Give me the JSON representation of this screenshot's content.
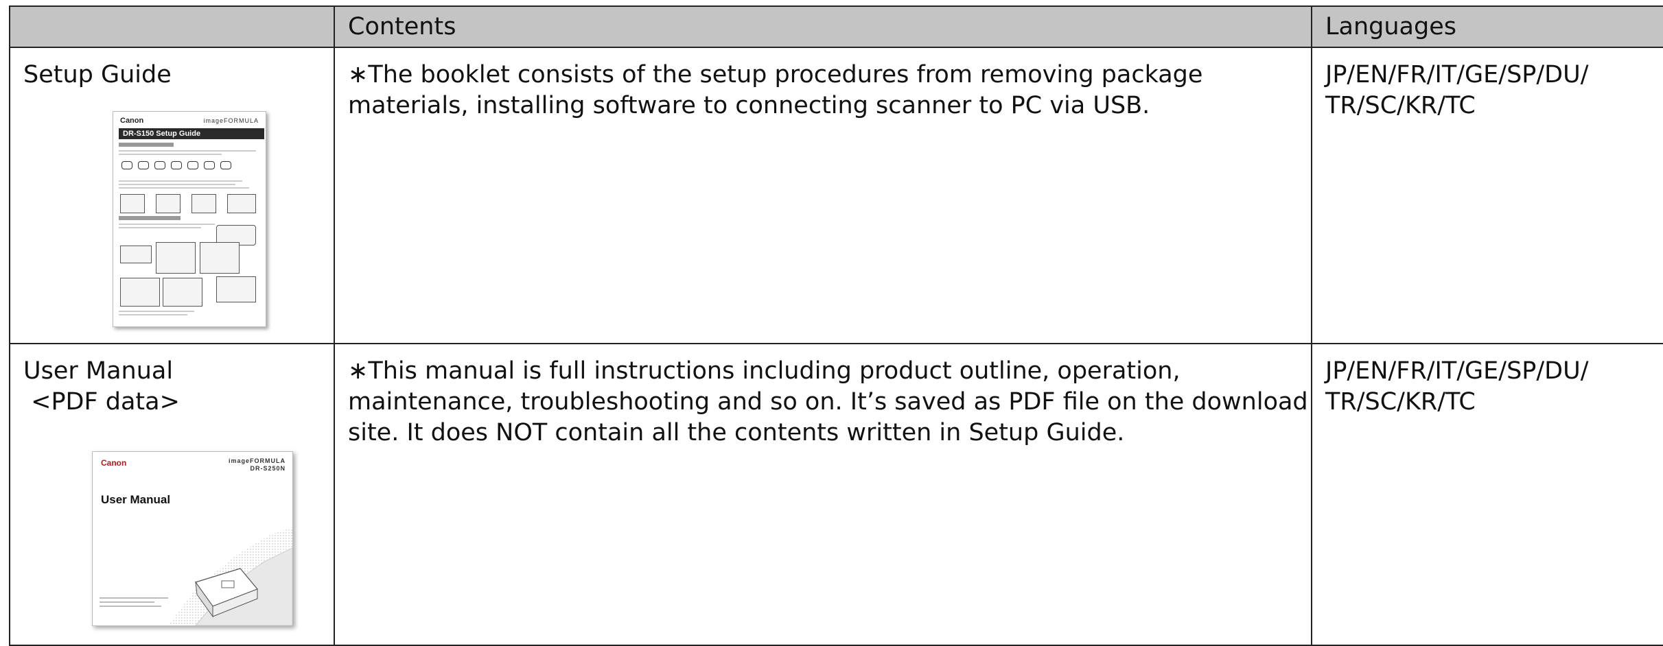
{
  "table": {
    "headers": [
      "",
      "Contents",
      "Languages"
    ],
    "rows": [
      {
        "document": "Setup Guide",
        "contents": "∗The booklet consists of the setup procedures from removing package materials, installing software to connecting scanner to PC via USB.",
        "languages": "JP/EN/FR/IT/GE/SP/DU/ TR/SC/KR/TC",
        "thumbnail": {
          "brand": "Canon",
          "product": "imageFORMULA",
          "title": "DR-S150 Setup Guide"
        }
      },
      {
        "document": "User Manual",
        "document_sub": " <PDF data>",
        "contents": "∗This manual is full instructions including product outline, operation, maintenance, troubleshooting and so on. It’s saved as PDF file on the download site. It does NOT contain all the contents written in Setup Guide.",
        "languages": "JP/EN/FR/IT/GE/SP/DU/ TR/SC/KR/TC",
        "thumbnail": {
          "brand": "Canon",
          "product": "imageFORMULA",
          "model": "DR-S250N",
          "title": "User Manual"
        }
      }
    ]
  },
  "colors": {
    "header_bg": "#c4c4c4",
    "border": "#222222",
    "canon_red": "#b01c20"
  }
}
